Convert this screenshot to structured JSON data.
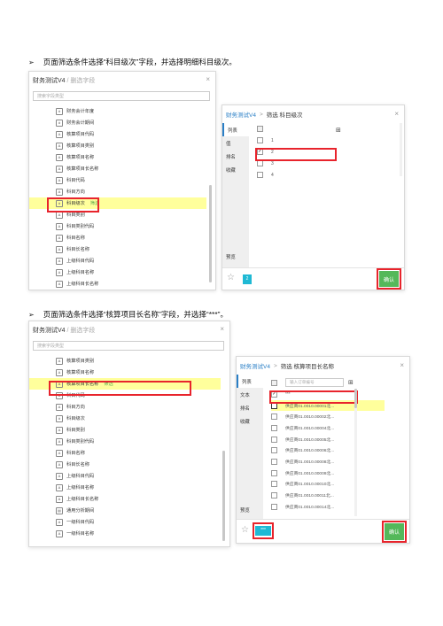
{
  "step1": {
    "arrow": "➢",
    "text": "页面筛选条件选择“科目级次”字段，并选择明细科目级次。"
  },
  "step2": {
    "arrow": "➢",
    "text": "页面筛选条件选择“核算项目长名称”字段，并选择“***”。"
  },
  "panel1": {
    "title": "财务测试V4",
    "subtitle": "/ 删选字段",
    "close": "×",
    "search_placeholder": "搜索字段类型",
    "items": [
      {
        "icon": "#",
        "label": "财务会计年度"
      },
      {
        "icon": "#",
        "label": "财务会计期间"
      },
      {
        "icon": "A",
        "label": "核算项目代码"
      },
      {
        "icon": "A",
        "label": "核算项目类别"
      },
      {
        "icon": "A",
        "label": "核算项目名称"
      },
      {
        "icon": "A",
        "label": "核算项目长名称"
      },
      {
        "icon": "A",
        "label": "科目代码"
      },
      {
        "icon": "A",
        "label": "科目方向"
      },
      {
        "icon": "#",
        "label": "科目级次",
        "tag": "筛选"
      },
      {
        "icon": "A",
        "label": "科目类别"
      },
      {
        "icon": "A",
        "label": "科目类别代码"
      },
      {
        "icon": "A",
        "label": "科目名称"
      },
      {
        "icon": "A",
        "label": "科目长名称"
      },
      {
        "icon": "A",
        "label": "上级科目代码"
      },
      {
        "icon": "A",
        "label": "上级科目名称"
      },
      {
        "icon": "A",
        "label": "上级科目长名称"
      }
    ]
  },
  "dialog1": {
    "crumb1": "财务测试V4",
    "sep": ">",
    "crumb2": "筛选 科目级次",
    "close": "×",
    "tabs": [
      "列表",
      "值",
      "排名",
      "收藏",
      "预览"
    ],
    "options": [
      "",
      "1",
      "2",
      "3",
      "4"
    ],
    "grid_icon": "⊞",
    "chip": "2",
    "ok": "确认",
    "star": "☆"
  },
  "panel2": {
    "title": "财务测试V4",
    "subtitle": "/ 删选字段",
    "close": "×",
    "search_placeholder": "搜索字段类型",
    "items": [
      {
        "icon": "A",
        "label": "核算项目类别"
      },
      {
        "icon": "A",
        "label": "核算项目名称"
      },
      {
        "icon": "A",
        "label": "核算项目长名称",
        "tag": "筛选"
      },
      {
        "icon": "A",
        "label": "科目代码"
      },
      {
        "icon": "A",
        "label": "科目方向"
      },
      {
        "icon": "#",
        "label": "科目级次"
      },
      {
        "icon": "A",
        "label": "科目类别"
      },
      {
        "icon": "A",
        "label": "科目类别代码"
      },
      {
        "icon": "A",
        "label": "科目名称"
      },
      {
        "icon": "A",
        "label": "科目长名称"
      },
      {
        "icon": "A",
        "label": "上级科目代码"
      },
      {
        "icon": "A",
        "label": "上级科目名称"
      },
      {
        "icon": "A",
        "label": "上级科目长名称"
      },
      {
        "icon": "▤",
        "label": "通用分析期间"
      },
      {
        "icon": "A",
        "label": "一级科目代码"
      },
      {
        "icon": "A",
        "label": "一级科目名称"
      }
    ]
  },
  "dialog2": {
    "crumb1": "财务测试V4",
    "sep": ">",
    "crumb2": "筛选 核算项目长名称",
    "close": "×",
    "tabs": [
      "列表",
      "文本",
      "排名",
      "收藏",
      "预览"
    ],
    "search_placeholder": "输入订单编号",
    "grid_icon": "⊞",
    "options": [
      "***",
      "供应商01.0010.00001北...",
      "供应商01.0010.00002北...",
      "供应商01.0010.00004北...",
      "供应商01.0010.00005北...",
      "供应商01.0010.00006北...",
      "供应商01.0010.00008北...",
      "供应商01.0010.00009北...",
      "供应商01.0010.00010北...",
      "供应商01.0010.00011北...",
      "供应商01.0010.00014北..."
    ],
    "chip": "***",
    "ok": "确认",
    "star": "☆"
  }
}
